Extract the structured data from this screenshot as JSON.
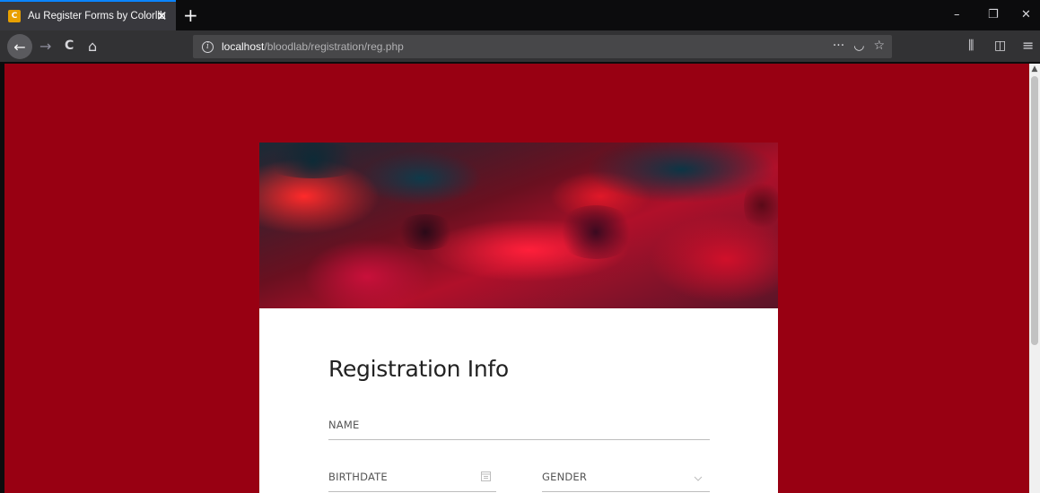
{
  "browser": {
    "tab": {
      "favicon": "C",
      "title": "Au Register Forms by Colorlib",
      "close": "✕"
    },
    "new_tab": "+",
    "window_controls": {
      "minimize": "–",
      "restore": "❐",
      "close": "✕"
    },
    "nav": {
      "back": "←",
      "forward": "→",
      "reload": "C",
      "home": "⌂"
    },
    "url": {
      "host": "localhost",
      "path": "/bloodlab/registration/reg.php",
      "info": "i"
    },
    "url_actions": {
      "more": "···",
      "pocket": "◡",
      "bookmark": "☆"
    },
    "toolbar": {
      "library": "⫼",
      "sidebar": "◫",
      "menu": "≡"
    }
  },
  "page": {
    "background_color": "#980012",
    "form": {
      "title": "Registration Info",
      "fields": {
        "name": {
          "label": "NAME"
        },
        "birthdate": {
          "label": "BIRTHDATE",
          "icon": "calendar-icon"
        },
        "gender": {
          "label": "GENDER",
          "icon": "chevron-down-icon"
        }
      }
    }
  }
}
